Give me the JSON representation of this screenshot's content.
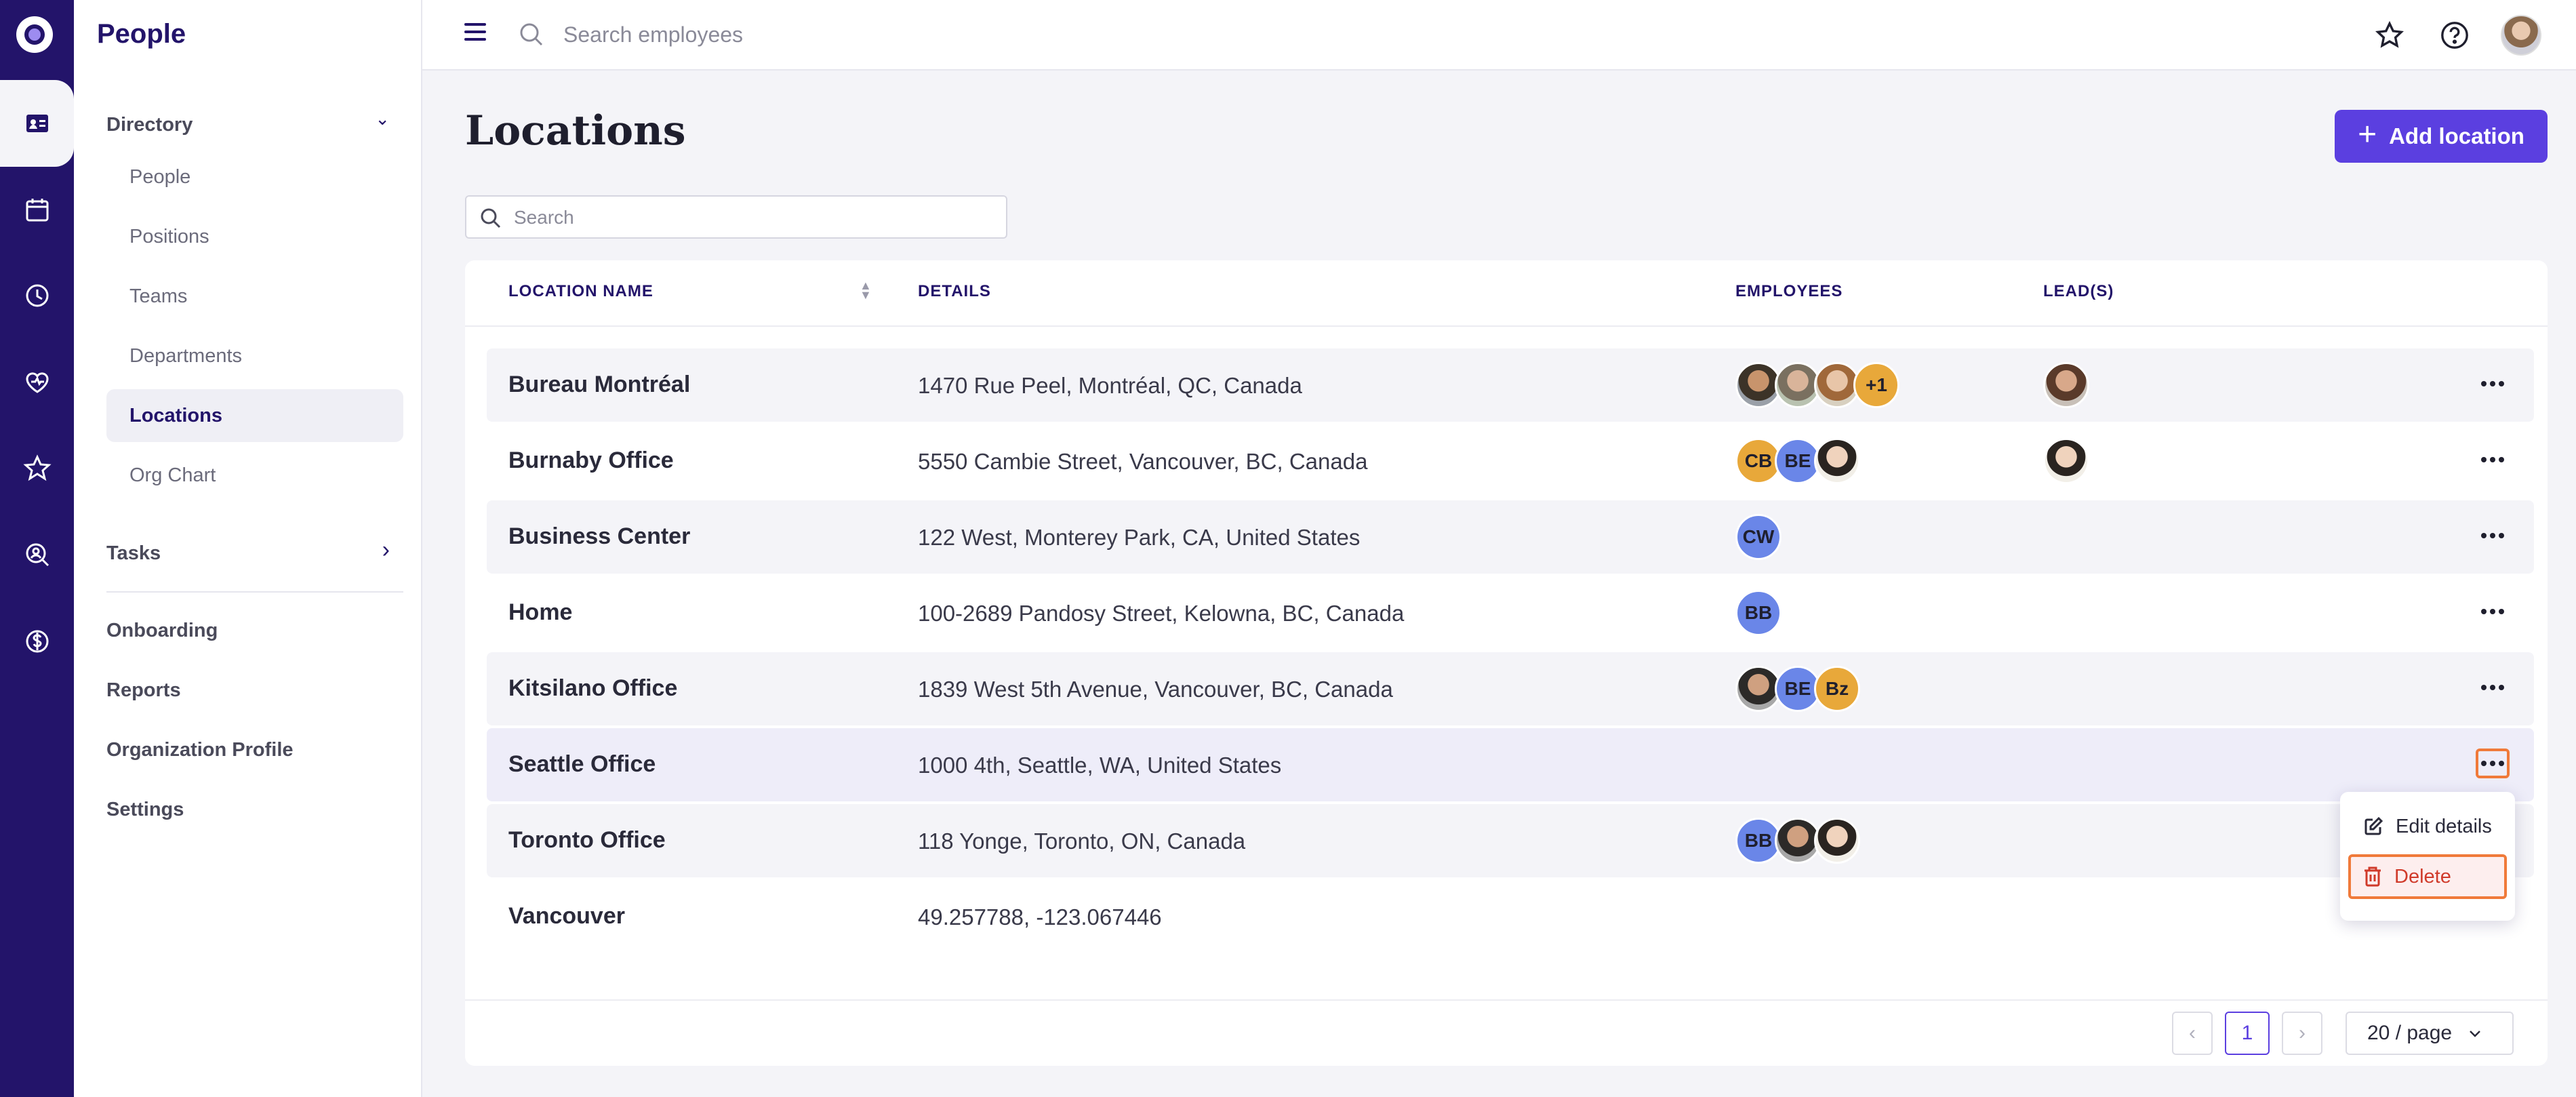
{
  "app": {
    "title": "People"
  },
  "topbar": {
    "search_placeholder": "Search employees"
  },
  "sidebar": {
    "sections": [
      {
        "label": "Directory",
        "chevron": "⌄"
      },
      {
        "label": "Tasks",
        "chevron": "›"
      }
    ],
    "directory_items": [
      "People",
      "Positions",
      "Teams",
      "Departments",
      "Locations",
      "Org Chart"
    ],
    "active_item": "Locations",
    "bottom_items": [
      "Onboarding",
      "Reports",
      "Organization Profile",
      "Settings"
    ]
  },
  "page": {
    "title": "Locations",
    "add_button": "Add location",
    "search_placeholder": "Search"
  },
  "table": {
    "headers": [
      "LOCATION NAME",
      "DETAILS",
      "EMPLOYEES",
      "LEAD(S)"
    ],
    "rows": [
      {
        "name": "Bureau Montréal",
        "details": "1470 Rue Peel, Montréal, QC, Canada",
        "employees": [
          "photo",
          "photo",
          "photo",
          "+1"
        ],
        "leads": [
          "photo"
        ]
      },
      {
        "name": "Burnaby Office",
        "details": "5550 Cambie Street, Vancouver, BC, Canada",
        "employees": [
          "CB",
          "BE",
          "photo"
        ],
        "leads": [
          "photo"
        ]
      },
      {
        "name": "Business Center",
        "details": "122 West, Monterey Park, CA, United States",
        "employees": [
          "CW"
        ],
        "leads": []
      },
      {
        "name": "Home",
        "details": "100-2689 Pandosy Street, Kelowna, BC, Canada",
        "employees": [
          "BB"
        ],
        "leads": []
      },
      {
        "name": "Kitsilano Office",
        "details": "1839 West 5th Avenue, Vancouver, BC, Canada",
        "employees": [
          "photo",
          "BE",
          "Bz"
        ],
        "leads": []
      },
      {
        "name": "Seattle Office",
        "details": "1000 4th, Seattle, WA, United States",
        "employees": [],
        "leads": []
      },
      {
        "name": "Toronto Office",
        "details": "118 Yonge, Toronto, ON, Canada",
        "employees": [
          "BB",
          "photo",
          "photo"
        ],
        "leads": []
      },
      {
        "name": "Vancouver",
        "details": "49.257788, -123.067446",
        "employees": [],
        "leads": []
      }
    ]
  },
  "context_menu": {
    "edit": "Edit details",
    "delete": "Delete"
  },
  "pagination": {
    "prev": "‹",
    "current": "1",
    "next": "›",
    "page_size": "20 / page"
  },
  "colors": {
    "rail": "#23146a",
    "accent": "#5b3fe0",
    "highlight": "#f07a3a",
    "danger": "#d03a2a"
  }
}
